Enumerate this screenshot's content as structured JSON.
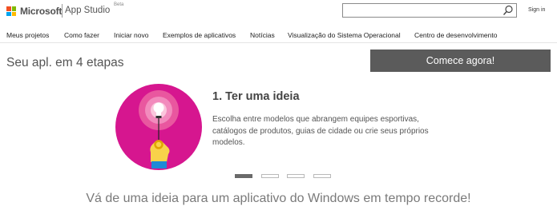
{
  "header": {
    "brand": "Microsoft",
    "product": "App Studio",
    "beta": "Beta",
    "search_value": "",
    "search_icon": "search-icon",
    "signin": "Sign in"
  },
  "nav": {
    "items": [
      "Meus projetos",
      "Como fazer",
      "Iniciar novo",
      "Exemplos de aplicativos",
      "Notícias",
      "Visualização do Sistema Operacional",
      "Centro de desenvolvimento"
    ]
  },
  "main": {
    "steps_title": "Seu apl. em 4 etapas",
    "cta_label": "Comece agora!",
    "step": {
      "title": "1. Ter uma ideia",
      "description": "Escolha entre modelos que abrangem equipes esportivas, catálogos de produtos, guias de cidade ou crie seus próprios modelos.",
      "illustration": "lightbulb-idea-icon"
    },
    "carousel": {
      "total": 4,
      "active": 1
    },
    "tagline": "Vá de uma ideia para um aplicativo do Windows em tempo recorde!"
  },
  "colors": {
    "accent_magenta": "#d6168f",
    "button_gray": "#5b5b5b"
  }
}
